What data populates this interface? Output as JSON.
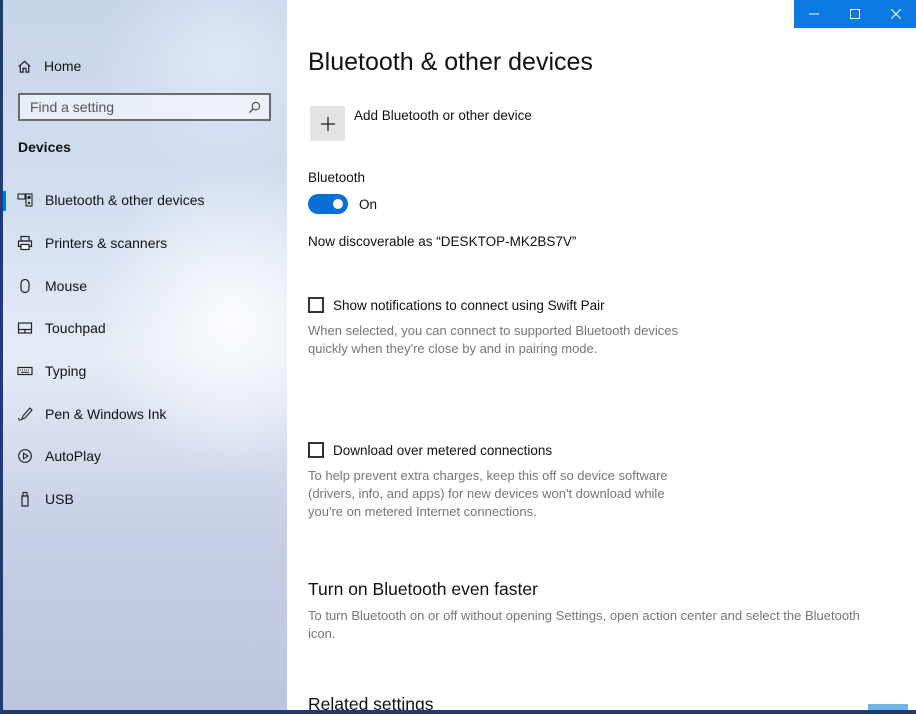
{
  "window": {
    "controls": {
      "minimize": "minimize",
      "maximize": "maximize",
      "close": "close"
    }
  },
  "sidebar": {
    "home_label": "Home",
    "search_placeholder": "Find a setting",
    "section_title": "Devices",
    "items": [
      {
        "label": "Bluetooth & other devices",
        "icon": "bluetooth-devices-icon",
        "active": true
      },
      {
        "label": "Printers & scanners",
        "icon": "printer-icon",
        "active": false
      },
      {
        "label": "Mouse",
        "icon": "mouse-icon",
        "active": false
      },
      {
        "label": "Touchpad",
        "icon": "touchpad-icon",
        "active": false
      },
      {
        "label": "Typing",
        "icon": "keyboard-icon",
        "active": false
      },
      {
        "label": "Pen & Windows Ink",
        "icon": "pen-icon",
        "active": false
      },
      {
        "label": "AutoPlay",
        "icon": "autoplay-icon",
        "active": false
      },
      {
        "label": "USB",
        "icon": "usb-icon",
        "active": false
      }
    ]
  },
  "main": {
    "title": "Bluetooth & other devices",
    "add_device_label": "Add Bluetooth or other device",
    "bluetooth_label": "Bluetooth",
    "bluetooth_state": "On",
    "bluetooth_on": true,
    "discoverable_text": "Now discoverable as “DESKTOP-MK2BS7V”",
    "swift_pair": {
      "label": "Show notifications to connect using Swift Pair",
      "checked": false,
      "description_line1": "When selected, you can connect to supported Bluetooth devices",
      "description_line2": "quickly when they're close by and in pairing mode."
    },
    "metered": {
      "label": "Download over metered connections",
      "checked": false,
      "description_line1": "To help prevent extra charges, keep this off so device software",
      "description_line2": "(drivers, info, and apps) for new devices won't download while",
      "description_line3": "you're on metered Internet connections."
    },
    "faster": {
      "heading": "Turn on Bluetooth even faster",
      "description_line1": "To turn Bluetooth on or off without opening Settings, open action center and select the Bluetooth",
      "description_line2": "icon."
    },
    "related_heading": "Related settings"
  },
  "colors": {
    "accent": "#0078d7",
    "titlebar": "#0a7ae2"
  }
}
